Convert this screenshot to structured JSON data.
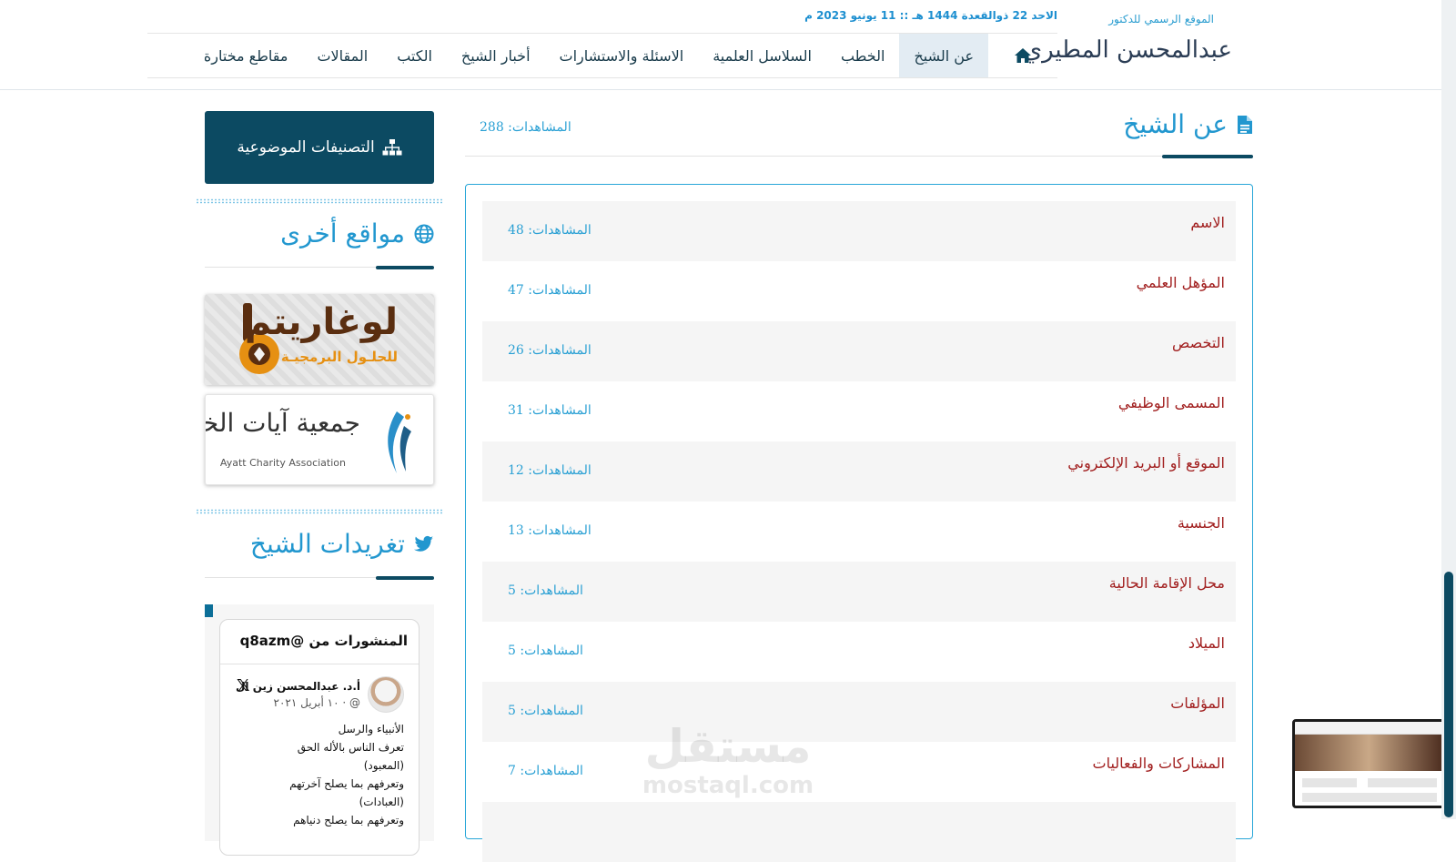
{
  "header": {
    "logo_subtitle": "الموقع الرسمي للدكتور",
    "logo_name": "عبدالمحسن المطيري",
    "date_line": "الاحد 22 ذوالقعدة 1444 هـ :: 11 يونيو 2023 م"
  },
  "nav": {
    "home_icon": "home-icon",
    "items": [
      {
        "label": "عن الشيخ"
      },
      {
        "label": "الخطب"
      },
      {
        "label": "السلاسل العلمية"
      },
      {
        "label": "الاسئلة والاستشارات"
      },
      {
        "label": "أخبار الشيخ"
      },
      {
        "label": "الكتب"
      },
      {
        "label": "المقالات"
      },
      {
        "label": "مقاطع مختارة"
      }
    ]
  },
  "section": {
    "title": "عن الشيخ",
    "views": "المشاهدات: 288"
  },
  "list": [
    {
      "title": "الاسم",
      "views": "المشاهدات: 48"
    },
    {
      "title": "المؤهل العلمي",
      "views": "المشاهدات: 47"
    },
    {
      "title": "التخصص",
      "views": "المشاهدات: 26"
    },
    {
      "title": "المسمى الوظيفي",
      "views": "المشاهدات: 31"
    },
    {
      "title": "الموقع أو البريد الإلكتروني",
      "views": "المشاهدات: 12"
    },
    {
      "title": "الجنسية",
      "views": "المشاهدات: 13"
    },
    {
      "title": "محل الإقامة الحالية",
      "views": "المشاهدات: 5"
    },
    {
      "title": "الميلاد",
      "views": "المشاهدات: 5"
    },
    {
      "title": "المؤلفات",
      "views": "المشاهدات: 5"
    },
    {
      "title": "المشاركات والفعاليات",
      "views": "المشاهدات: 7"
    },
    {
      "title": "",
      "views": ""
    }
  ],
  "sidebar": {
    "categories_label": "التصنيفات الموضوعية",
    "other_sites_title": "مواقع أخرى",
    "banner1": {
      "name": "لوغاريتم",
      "tagline": "للحلـول البرمجيـة"
    },
    "banner2": {
      "name": "جمعية آيات الخيرية",
      "english": "Ayatt Charity Association"
    },
    "tweets_title": "تغريدات الشيخ"
  },
  "tweet_embed": {
    "header": "المنشورات من @q8azm",
    "author": "أ.د. عبدالمحسن زين ال",
    "handle_date": "@‏ · ١٠ أبريل ٢٠٢١",
    "x_glyph": "𝕏",
    "lines": [
      "الأنبياء والرسل",
      "تعرف الناس بالأله الحق",
      "(المعبود)",
      "وتعرفهم بما يصلح آخرتهم",
      "(العبادات)",
      "وتعرفهم بما يصلح دنياهم"
    ]
  },
  "watermark": {
    "arabic": "مستقل",
    "latin": "mostaql.com"
  },
  "colors": {
    "brand_dark": "#0c4a62",
    "accent_blue": "#2297cf",
    "item_title": "#a11e1e"
  }
}
